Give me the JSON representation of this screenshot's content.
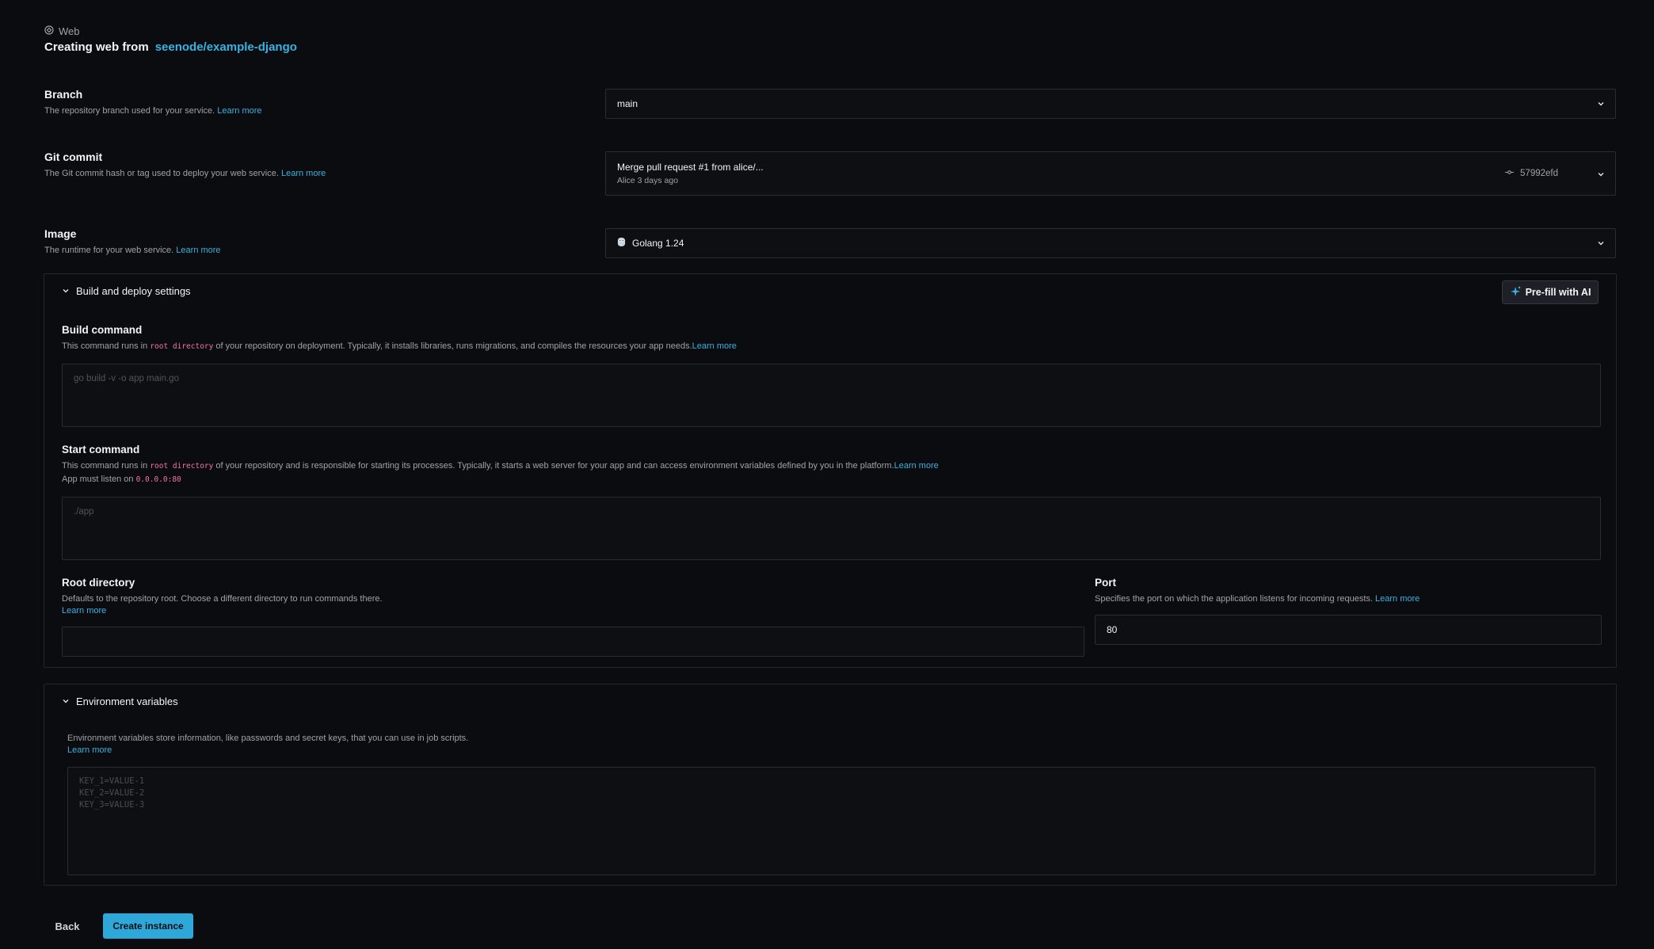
{
  "header": {
    "breadcrumb": "Web",
    "title_prefix": "Creating web from",
    "repo": "seenode/example-django"
  },
  "fields": {
    "branch": {
      "label": "Branch",
      "description": "The repository branch used for your service.",
      "learn_more": "Learn more",
      "value": "main"
    },
    "commit": {
      "label": "Git commit",
      "description": "The Git commit hash or tag used to deploy your web service.",
      "learn_more": "Learn more",
      "message": "Merge pull request #1 from alice/...",
      "meta": "Alice 3 days ago",
      "hash": "57992efd"
    },
    "image": {
      "label": "Image",
      "description": "The runtime for your web service.",
      "learn_more": "Learn more",
      "value": "Golang 1.24"
    }
  },
  "build_panel": {
    "title": "Build and deploy settings",
    "ai_button": "Pre-fill with AI",
    "build_command": {
      "label": "Build command",
      "desc_before": "This command runs in",
      "code": "root directory",
      "desc_after": "of your repository on deployment. Typically, it installs libraries, runs migrations, and compiles the resources your app needs.",
      "learn_more": "Learn more",
      "placeholder": "go build -v -o app main.go"
    },
    "start_command": {
      "label": "Start command",
      "desc_before": "This command runs in",
      "code": "root directory",
      "desc_after": "of your repository and is responsible for starting its processes. Typically, it starts a web server for your app and can access environment variables defined by you in the platform.",
      "learn_more": "Learn more",
      "listen_prefix": "App must listen on",
      "listen_addr": "0.0.0.0:80",
      "placeholder": "./app"
    },
    "root_directory": {
      "label": "Root directory",
      "description": "Defaults to the repository root. Choose a different directory to run commands there.",
      "learn_more": "Learn more",
      "value": ""
    },
    "port": {
      "label": "Port",
      "description": "Specifies the port on which the application listens for incoming requests.",
      "learn_more": "Learn more",
      "value": "80"
    }
  },
  "env_panel": {
    "title": "Environment variables",
    "description": "Environment variables store information, like passwords and secret keys, that you can use in job scripts.",
    "learn_more": "Learn more",
    "placeholder_lines": [
      "KEY_1=VALUE-1",
      "KEY_2=VALUE-2",
      "KEY_3=VALUE-3"
    ]
  },
  "footer": {
    "back": "Back",
    "create": "Create instance"
  },
  "colors": {
    "background": "#0b0c10",
    "accent": "#2ea8d8",
    "link": "#38b2e0",
    "code": "#f472a0"
  }
}
